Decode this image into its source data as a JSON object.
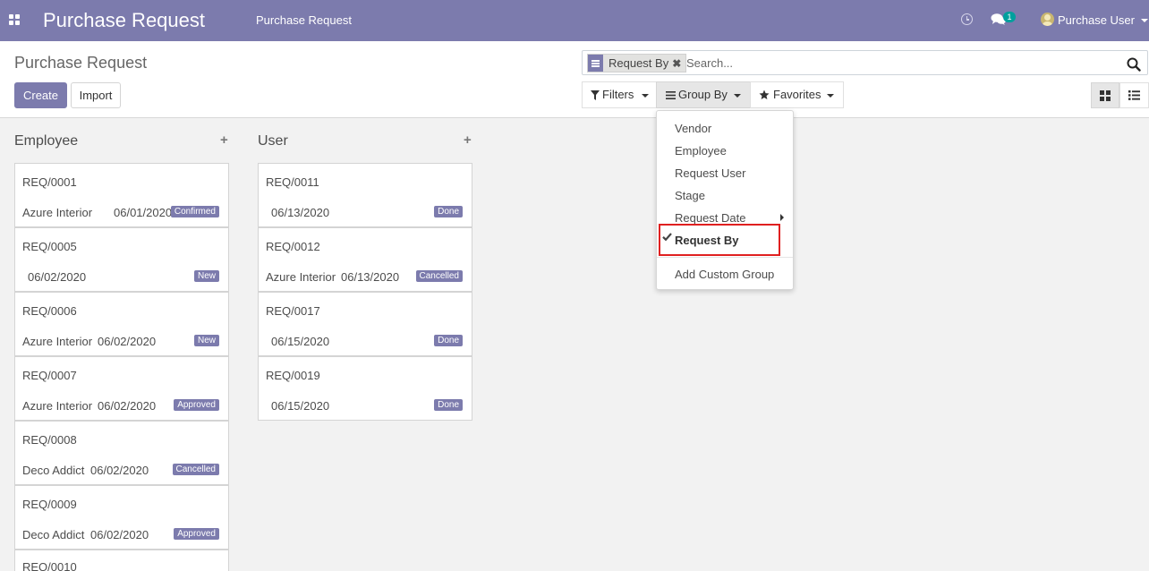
{
  "navbar": {
    "app_title": "Purchase Request",
    "menu_item": "Purchase Request",
    "chat_count": "1",
    "user_name": "Purchase User",
    "accent_color": "#7c7bad"
  },
  "control_panel": {
    "title": "Purchase Request",
    "create_label": "Create",
    "import_label": "Import",
    "search": {
      "facet_label": "Request By",
      "placeholder": "Search..."
    },
    "filters_label": "Filters",
    "groupby_label": "Group By",
    "favorites_label": "Favorites"
  },
  "groupby_menu": {
    "items": [
      "Vendor",
      "Employee",
      "Request User",
      "Stage",
      "Request Date",
      "Request By"
    ],
    "selected": "Request By",
    "custom_label": "Add Custom Group"
  },
  "kanban": {
    "columns": [
      {
        "title": "Employee",
        "cards": [
          {
            "ref": "REQ/0001",
            "partner": "Azure Interior",
            "date": "06/01/2020",
            "status": "Confirmed"
          },
          {
            "ref": "REQ/0005",
            "partner": "",
            "date": "06/02/2020",
            "status": "New"
          },
          {
            "ref": "REQ/0006",
            "partner": "Azure Interior",
            "date": "06/02/2020",
            "status": "New"
          },
          {
            "ref": "REQ/0007",
            "partner": "Azure Interior",
            "date": "06/02/2020",
            "status": "Approved"
          },
          {
            "ref": "REQ/0008",
            "partner": "Deco Addict",
            "date": "06/02/2020",
            "status": "Cancelled"
          },
          {
            "ref": "REQ/0009",
            "partner": "Deco Addict",
            "date": "06/02/2020",
            "status": "Approved"
          },
          {
            "ref": "REQ/0010",
            "partner": "",
            "date": "",
            "status": ""
          }
        ]
      },
      {
        "title": "User",
        "cards": [
          {
            "ref": "REQ/0011",
            "partner": "",
            "date": "06/13/2020",
            "status": "Done"
          },
          {
            "ref": "REQ/0012",
            "partner": "Azure Interior",
            "date": "06/13/2020",
            "status": "Cancelled"
          },
          {
            "ref": "REQ/0017",
            "partner": "",
            "date": "06/15/2020",
            "status": "Done"
          },
          {
            "ref": "REQ/0019",
            "partner": "",
            "date": "06/15/2020",
            "status": "Done"
          }
        ]
      }
    ]
  }
}
